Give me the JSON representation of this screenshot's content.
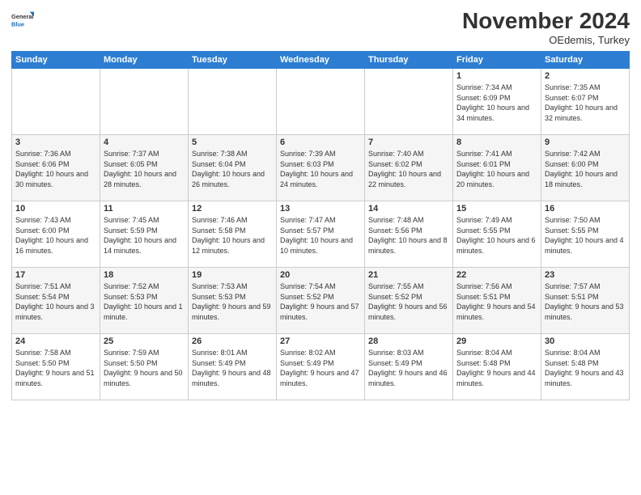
{
  "logo": {
    "general": "General",
    "blue": "Blue"
  },
  "header": {
    "month": "November 2024",
    "location": "OEdemis, Turkey"
  },
  "days_of_week": [
    "Sunday",
    "Monday",
    "Tuesday",
    "Wednesday",
    "Thursday",
    "Friday",
    "Saturday"
  ],
  "weeks": [
    [
      {
        "day": "",
        "info": ""
      },
      {
        "day": "",
        "info": ""
      },
      {
        "day": "",
        "info": ""
      },
      {
        "day": "",
        "info": ""
      },
      {
        "day": "",
        "info": ""
      },
      {
        "day": "1",
        "info": "Sunrise: 7:34 AM\nSunset: 6:09 PM\nDaylight: 10 hours and 34 minutes."
      },
      {
        "day": "2",
        "info": "Sunrise: 7:35 AM\nSunset: 6:07 PM\nDaylight: 10 hours and 32 minutes."
      }
    ],
    [
      {
        "day": "3",
        "info": "Sunrise: 7:36 AM\nSunset: 6:06 PM\nDaylight: 10 hours and 30 minutes."
      },
      {
        "day": "4",
        "info": "Sunrise: 7:37 AM\nSunset: 6:05 PM\nDaylight: 10 hours and 28 minutes."
      },
      {
        "day": "5",
        "info": "Sunrise: 7:38 AM\nSunset: 6:04 PM\nDaylight: 10 hours and 26 minutes."
      },
      {
        "day": "6",
        "info": "Sunrise: 7:39 AM\nSunset: 6:03 PM\nDaylight: 10 hours and 24 minutes."
      },
      {
        "day": "7",
        "info": "Sunrise: 7:40 AM\nSunset: 6:02 PM\nDaylight: 10 hours and 22 minutes."
      },
      {
        "day": "8",
        "info": "Sunrise: 7:41 AM\nSunset: 6:01 PM\nDaylight: 10 hours and 20 minutes."
      },
      {
        "day": "9",
        "info": "Sunrise: 7:42 AM\nSunset: 6:00 PM\nDaylight: 10 hours and 18 minutes."
      }
    ],
    [
      {
        "day": "10",
        "info": "Sunrise: 7:43 AM\nSunset: 6:00 PM\nDaylight: 10 hours and 16 minutes."
      },
      {
        "day": "11",
        "info": "Sunrise: 7:45 AM\nSunset: 5:59 PM\nDaylight: 10 hours and 14 minutes."
      },
      {
        "day": "12",
        "info": "Sunrise: 7:46 AM\nSunset: 5:58 PM\nDaylight: 10 hours and 12 minutes."
      },
      {
        "day": "13",
        "info": "Sunrise: 7:47 AM\nSunset: 5:57 PM\nDaylight: 10 hours and 10 minutes."
      },
      {
        "day": "14",
        "info": "Sunrise: 7:48 AM\nSunset: 5:56 PM\nDaylight: 10 hours and 8 minutes."
      },
      {
        "day": "15",
        "info": "Sunrise: 7:49 AM\nSunset: 5:55 PM\nDaylight: 10 hours and 6 minutes."
      },
      {
        "day": "16",
        "info": "Sunrise: 7:50 AM\nSunset: 5:55 PM\nDaylight: 10 hours and 4 minutes."
      }
    ],
    [
      {
        "day": "17",
        "info": "Sunrise: 7:51 AM\nSunset: 5:54 PM\nDaylight: 10 hours and 3 minutes."
      },
      {
        "day": "18",
        "info": "Sunrise: 7:52 AM\nSunset: 5:53 PM\nDaylight: 10 hours and 1 minute."
      },
      {
        "day": "19",
        "info": "Sunrise: 7:53 AM\nSunset: 5:53 PM\nDaylight: 9 hours and 59 minutes."
      },
      {
        "day": "20",
        "info": "Sunrise: 7:54 AM\nSunset: 5:52 PM\nDaylight: 9 hours and 57 minutes."
      },
      {
        "day": "21",
        "info": "Sunrise: 7:55 AM\nSunset: 5:52 PM\nDaylight: 9 hours and 56 minutes."
      },
      {
        "day": "22",
        "info": "Sunrise: 7:56 AM\nSunset: 5:51 PM\nDaylight: 9 hours and 54 minutes."
      },
      {
        "day": "23",
        "info": "Sunrise: 7:57 AM\nSunset: 5:51 PM\nDaylight: 9 hours and 53 minutes."
      }
    ],
    [
      {
        "day": "24",
        "info": "Sunrise: 7:58 AM\nSunset: 5:50 PM\nDaylight: 9 hours and 51 minutes."
      },
      {
        "day": "25",
        "info": "Sunrise: 7:59 AM\nSunset: 5:50 PM\nDaylight: 9 hours and 50 minutes."
      },
      {
        "day": "26",
        "info": "Sunrise: 8:01 AM\nSunset: 5:49 PM\nDaylight: 9 hours and 48 minutes."
      },
      {
        "day": "27",
        "info": "Sunrise: 8:02 AM\nSunset: 5:49 PM\nDaylight: 9 hours and 47 minutes."
      },
      {
        "day": "28",
        "info": "Sunrise: 8:03 AM\nSunset: 5:49 PM\nDaylight: 9 hours and 46 minutes."
      },
      {
        "day": "29",
        "info": "Sunrise: 8:04 AM\nSunset: 5:48 PM\nDaylight: 9 hours and 44 minutes."
      },
      {
        "day": "30",
        "info": "Sunrise: 8:04 AM\nSunset: 5:48 PM\nDaylight: 9 hours and 43 minutes."
      }
    ]
  ]
}
